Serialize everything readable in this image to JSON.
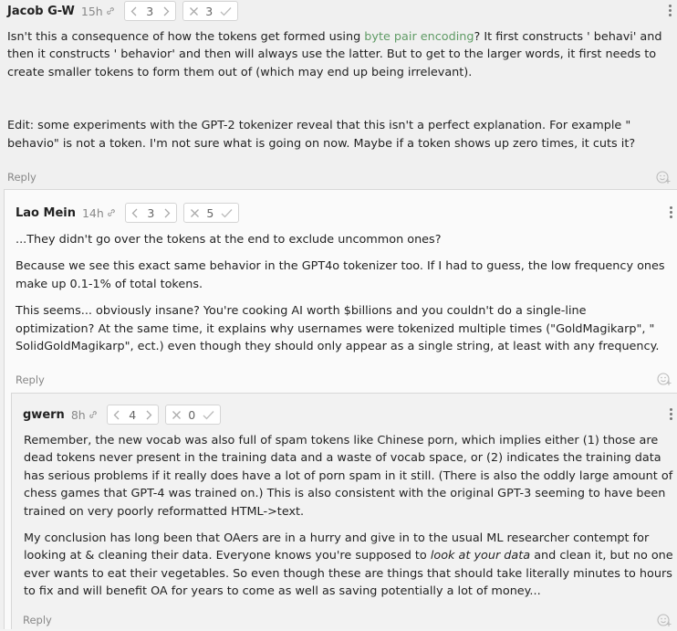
{
  "comments": [
    {
      "author": "Jacob G-W",
      "time": "15h",
      "karma": "3",
      "agreement": "3",
      "paragraphs": [
        {
          "before": "Isn't this a consequence of how the tokens get formed using ",
          "link": "byte pair encoding",
          "after": "? It first constructs ' behavi' and then it constructs ' behavior' and then will always use the latter. But to get to the larger words, it first needs to create smaller tokens to form them out of (which may end up being irrelevant)."
        },
        {
          "before": "Edit: some experiments with the GPT-2 tokenizer reveal that this isn't a perfect explanation. For example \"  behavio\" is not a token. I'm not sure what is going on now. Maybe if a token shows up zero times, it cuts it?"
        }
      ],
      "reply": "Reply"
    },
    {
      "author": "Lao Mein",
      "time": "14h",
      "karma": "3",
      "agreement": "5",
      "paragraphs": [
        "...They didn't go over the tokens at the end to exclude uncommon ones?",
        "Because we see this exact same behavior in the GPT4o tokenizer too. If I had to guess, the low frequency ones make up 0.1-1% of total tokens.",
        "This seems... obviously insane? You're cooking AI worth $billions and you couldn't do a single-line optimization? At the same time, it explains why usernames were tokenized multiple times (\"GoldMagikarp\", \" SolidGoldMagikarp\", ect.) even though they should only appear as a single string, at least with any frequency."
      ],
      "reply": "Reply"
    },
    {
      "author": "gwern",
      "time": "8h",
      "karma": "4",
      "agreement": "0",
      "paragraphs": [
        {
          "before": "Remember, the new vocab was also full of spam tokens like Chinese porn, which implies either (1) those are dead tokens never present in the training data and a waste of vocab space, or (2) indicates the training data has serious problems if it really does have a lot of porn spam in it still. (There is also the oddly large amount of chess games that GPT-4 was trained on.) This is also consistent with the original GPT-3 seeming to have been trained on very poorly reformatted HTML->text."
        },
        {
          "before": "My conclusion has long been that OAers are in a hurry and give in to the usual ML researcher contempt for looking at & cleaning their data. Everyone knows you're supposed to ",
          "emph": "look at your data",
          "after": " and clean it, but no one ever wants to eat their vegetables. So even though these are things that should take literally minutes to hours to fix and will benefit OA for years to come as well as saving potentially a lot of money..."
        }
      ],
      "reply": "Reply"
    }
  ],
  "icons": {
    "link": "link-icon",
    "karma_down": "chevron-left-icon",
    "karma_up": "chevron-right-icon",
    "disagree": "cross-icon",
    "agree": "check-icon",
    "menu": "vertical-dots-icon",
    "react": "add-reaction-icon"
  },
  "colors": {
    "link": "#5f9b65",
    "meta": "#888888"
  }
}
